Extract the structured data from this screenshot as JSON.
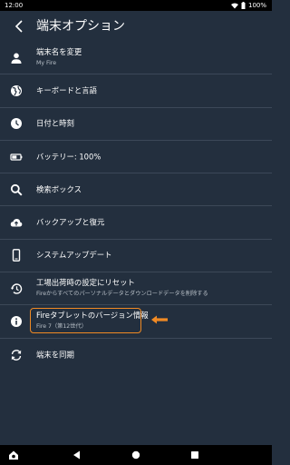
{
  "status": {
    "time": "12:00",
    "battery": "100%"
  },
  "header": {
    "title": "端末オプション"
  },
  "items": [
    {
      "icon": "person-icon",
      "label": "端末名を変更",
      "sub": "My Fire"
    },
    {
      "icon": "globe-icon",
      "label": "キーボードと言語",
      "sub": ""
    },
    {
      "icon": "clock-icon",
      "label": "日付と時刻",
      "sub": ""
    },
    {
      "icon": "battery-icon",
      "label": "バッテリー: 100%",
      "sub": ""
    },
    {
      "icon": "search-icon",
      "label": "検索ボックス",
      "sub": ""
    },
    {
      "icon": "cloud-upload-icon",
      "label": "バックアップと復元",
      "sub": ""
    },
    {
      "icon": "phone-icon",
      "label": "システムアップデート",
      "sub": ""
    },
    {
      "icon": "restore-icon",
      "label": "工場出荷時の設定にリセット",
      "sub": "Fireからすべてのパーソナルデータとダウンロードデータを削除する"
    },
    {
      "icon": "info-icon",
      "label": "Fireタブレットのバージョン情報",
      "sub": "Fire 7（第12世代）"
    },
    {
      "icon": "sync-icon",
      "label": "端末を同期",
      "sub": ""
    }
  ],
  "colors": {
    "background": "#232f3e",
    "accent": "#f08a24",
    "divider": "#3c4858"
  }
}
